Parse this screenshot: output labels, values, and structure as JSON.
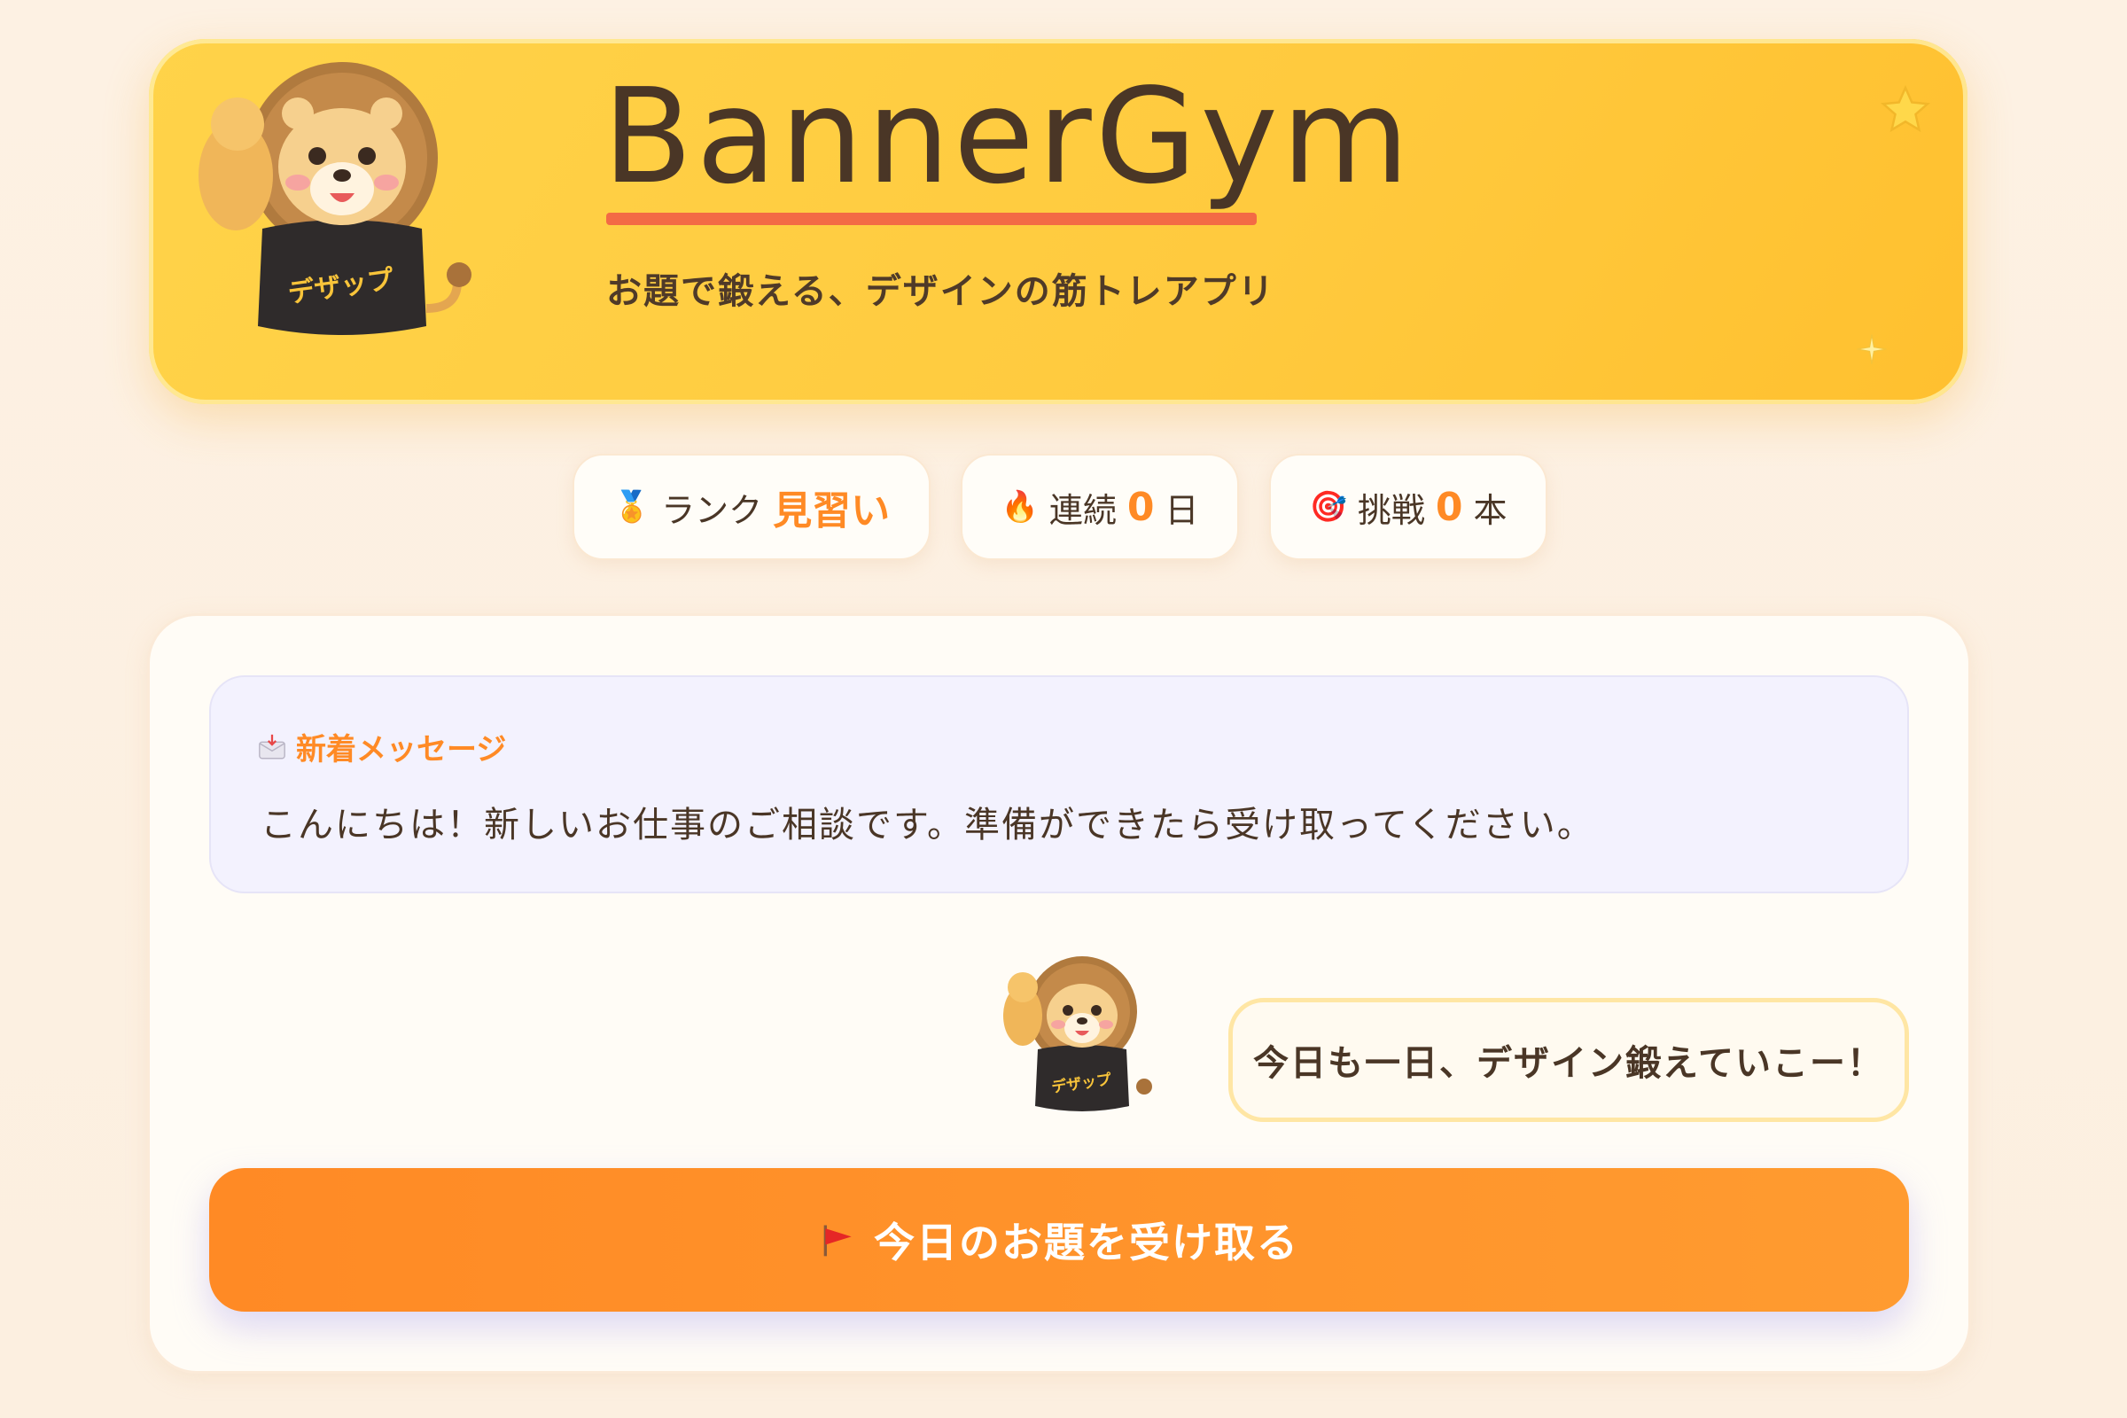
{
  "header": {
    "title": "BannerGym",
    "subtitle": "お題で鍛える、デザインの筋トレアプリ",
    "mascot_shirt_text": "デザップ"
  },
  "stats": {
    "rank": {
      "icon": "medal-icon",
      "label": "ランク",
      "value": "見習い"
    },
    "streak": {
      "icon": "fire-icon",
      "label": "連続",
      "value": "0",
      "unit": "日"
    },
    "challenge": {
      "icon": "target-icon",
      "label": "挑戦",
      "value": "0",
      "unit": "本"
    }
  },
  "message": {
    "label": "新着メッセージ",
    "body": "こんにちは！新しいお仕事のご相談です。準備ができたら受け取ってください。"
  },
  "mascot_bubble": "今日も一日、デザイン鍛えていこー！",
  "cta": {
    "label": "今日のお題を受け取る"
  },
  "colors": {
    "accent": "#ff8a25",
    "header_bg": "#ffcb40",
    "underline": "#f36a45"
  }
}
